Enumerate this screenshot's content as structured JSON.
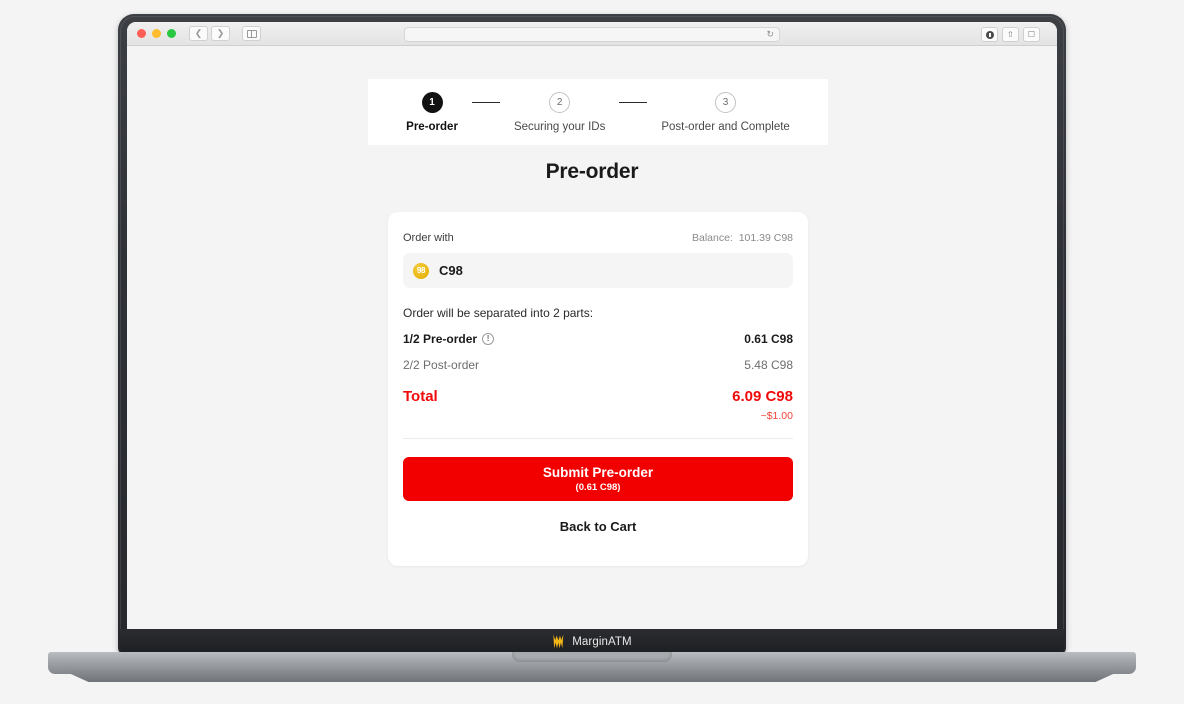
{
  "browser": {
    "address_value": "",
    "address_placeholder": "",
    "back_icon": "chevron-left-icon",
    "forward_icon": "chevron-right-icon",
    "sidebar_icon": "sidebar-toggle-icon",
    "reload_icon": "reload-icon",
    "downloads_icon": "downloads-icon",
    "share_icon": "share-icon",
    "tabs_icon": "tabs-overview-icon"
  },
  "stepper": {
    "steps": [
      {
        "number": "1",
        "label": "Pre-order",
        "state": "active"
      },
      {
        "number": "2",
        "label": "Securing your IDs",
        "state": "idle"
      },
      {
        "number": "3",
        "label": "Post-order and Complete",
        "state": "idle"
      }
    ]
  },
  "page": {
    "title": "Pre-order"
  },
  "order": {
    "order_with_label": "Order with",
    "balance_label": "Balance:",
    "balance_value": "101.39 C98",
    "token": {
      "icon_text": "98",
      "symbol": "C98"
    },
    "split_note": "Order will be separated into 2 parts:",
    "lines": [
      {
        "label": "1/2 Pre-order",
        "value": "0.61 C98",
        "emphasis": "bold",
        "info_icon": "info-icon"
      },
      {
        "label": "2/2 Post-order",
        "value": "5.48 C98",
        "emphasis": "regular",
        "info_icon": ""
      }
    ],
    "total": {
      "label": "Total",
      "value": "6.09 C98",
      "usd": "~$1.00"
    },
    "submit": {
      "main_label": "Submit Pre-order",
      "sub_label": "(0.61 C98)"
    },
    "back_label": "Back to Cart"
  },
  "footer": {
    "brand": "MarginATM",
    "logo_icon": "crown-icon"
  },
  "colors": {
    "accent_red": "#f20000",
    "token_gold": "#e8b712",
    "step_active": "#111111",
    "page_bg": "#f4f4f5"
  }
}
